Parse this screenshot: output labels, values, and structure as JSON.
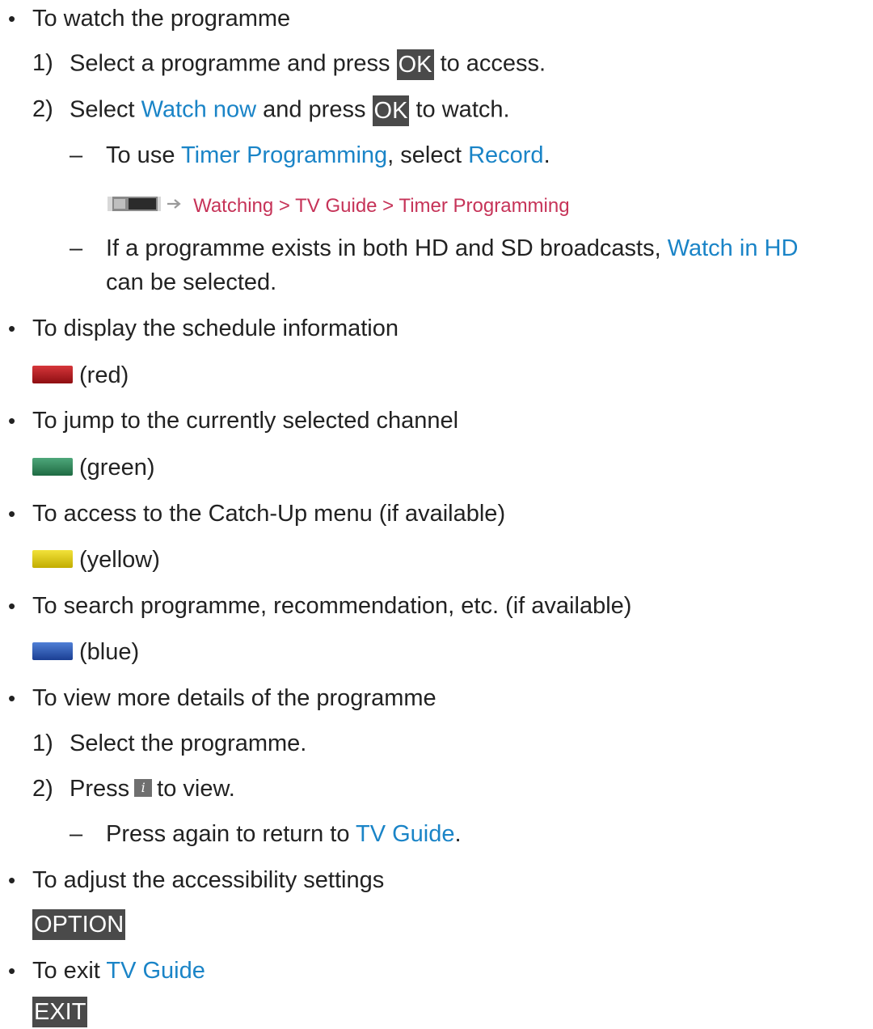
{
  "colors": {
    "red": "#b9161c",
    "green": "#2f8c5d",
    "yellow": "#e2cf10",
    "blue": "#2a58b3",
    "link": "#1a84c7",
    "reference": "#c63358",
    "key_bg": "#4a4a4a"
  },
  "items": {
    "watch": {
      "title": "To watch the programme",
      "s1_pre": "Select a programme and press",
      "s1_key": "OK",
      "s1_post": "to access.",
      "s2_pre": "Select",
      "s2_link": "Watch now",
      "s2_mid": "and press",
      "s2_key": "OK",
      "s2_post": "to watch.",
      "d1_pre": "To use",
      "d1_link1": "Timer Programming",
      "d1_mid": ", select",
      "d1_link2": "Record",
      "d1_post": ".",
      "ref_text": "Watching > TV Guide > Timer Programming",
      "d2_line1": "If a programme exists in both HD and SD broadcasts,",
      "d2_link": "Watch in HD",
      "d2_line2": "can be selected."
    },
    "schedule": {
      "title": "To display the schedule information",
      "key_label": "(red)"
    },
    "jump": {
      "title": "To jump to the currently selected channel",
      "key_label": "(green)"
    },
    "catchup": {
      "title": "To access to the Catch-Up menu (if available)",
      "key_label": "(yellow)"
    },
    "search": {
      "title": "To search programme, recommendation, etc. (if available)",
      "key_label": "(blue)"
    },
    "details": {
      "title": "To view more details of the programme",
      "s1": "Select the programme.",
      "s2_pre": "Press",
      "s2_post": "to view.",
      "d1_pre": "Press again to return to",
      "d1_link": "TV Guide",
      "d1_post": "."
    },
    "accessibility": {
      "title": "To adjust the accessibility settings",
      "key": "OPTION"
    },
    "exit": {
      "title_pre": "To exit",
      "title_link": "TV Guide",
      "key": "EXIT"
    }
  },
  "markers": {
    "bullet": "•",
    "dash": "–",
    "num1": "1)",
    "num2": "2)"
  },
  "icons": {
    "reference": "tv-guide-reference-icon",
    "arrow": "right-arrow-icon",
    "info": "info-icon"
  }
}
